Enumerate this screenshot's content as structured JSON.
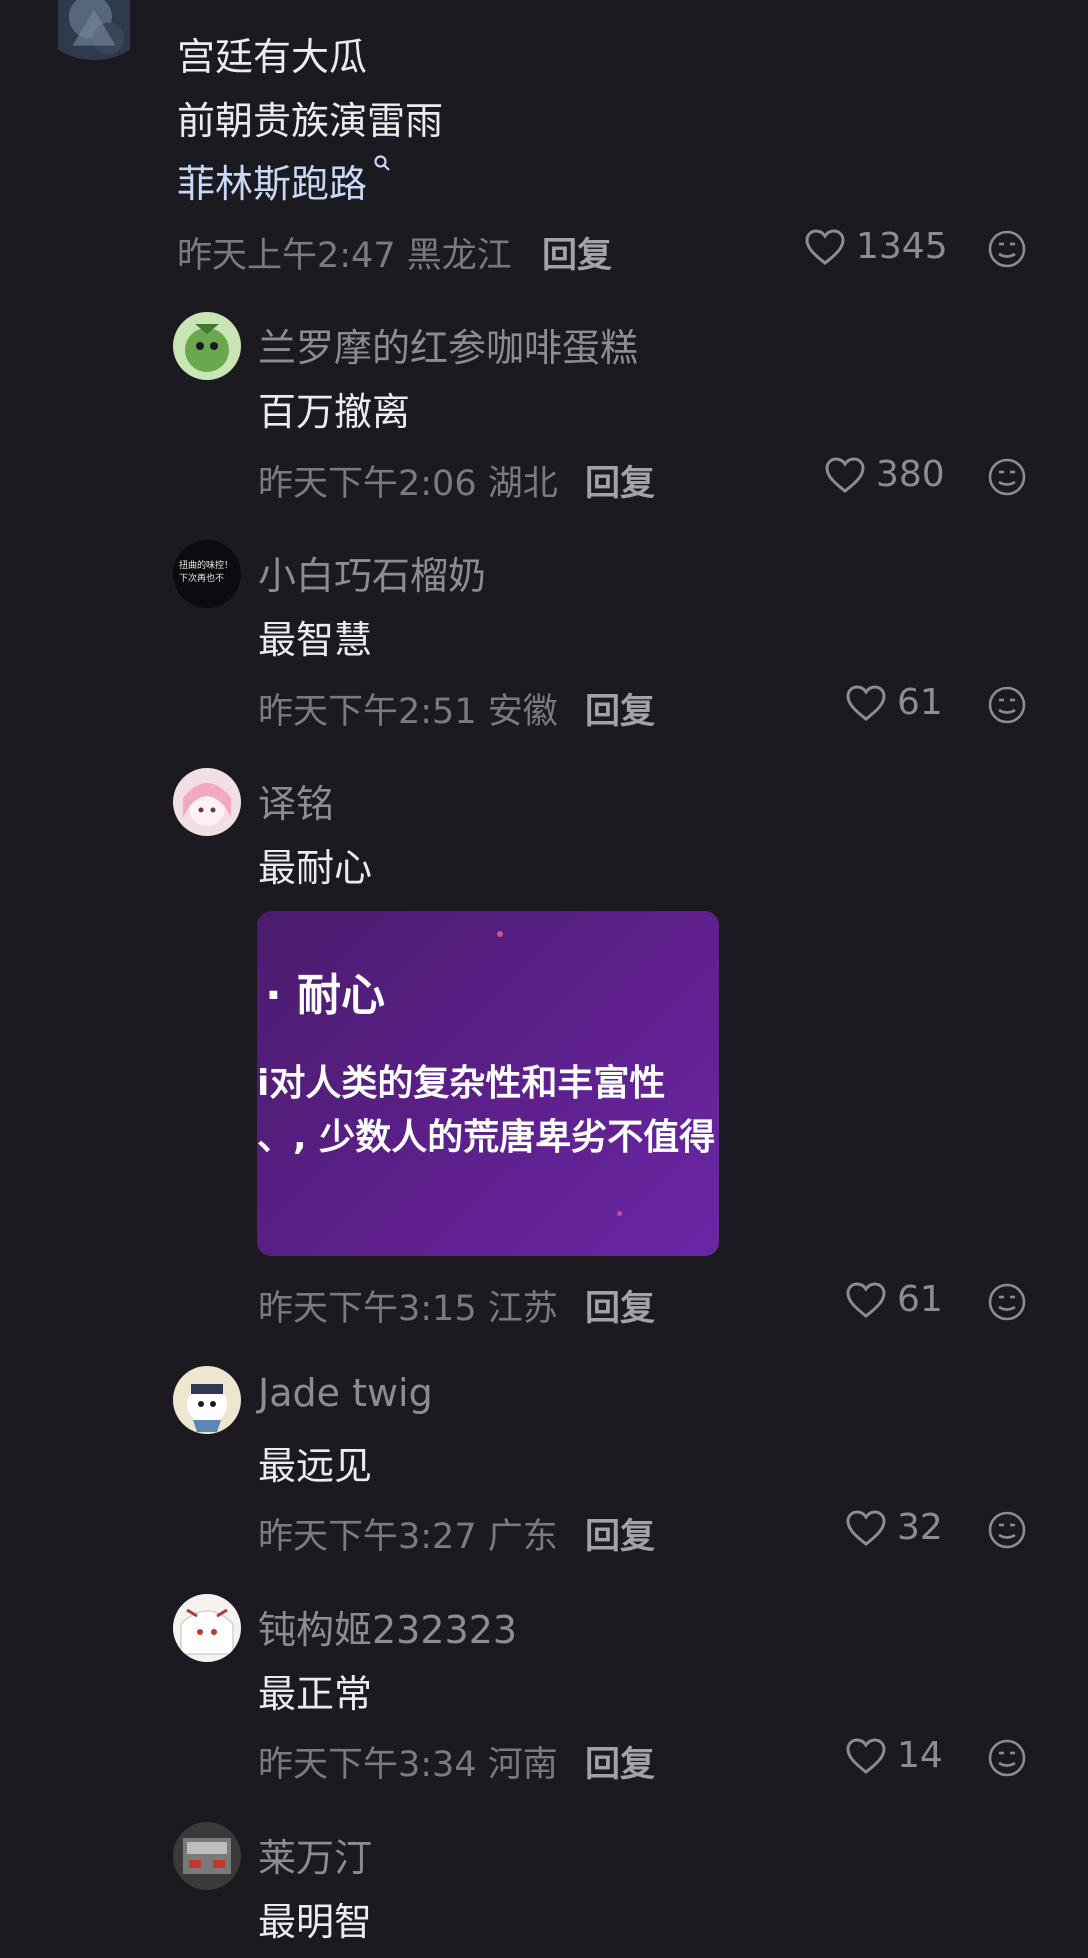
{
  "top_comment": {
    "lines": [
      "宫廷有大瓜",
      "前朝贵族演雷雨"
    ],
    "search_link": "菲林斯跑路",
    "time": "昨天上午2:47",
    "location": "黑龙江",
    "reply_label": "回复",
    "likes": "1345"
  },
  "replies": [
    {
      "name": "兰罗摩的红参咖啡蛋糕",
      "text": "百万撤离",
      "time": "昨天下午2:06",
      "location": "湖北",
      "reply_label": "回复",
      "likes": "380"
    },
    {
      "name": "小白巧石榴奶",
      "text": "最智慧",
      "time": "昨天下午2:51",
      "location": "安徽",
      "reply_label": "回复",
      "likes": "61",
      "avatar_text": [
        "扭曲的味控！",
        "下次再也不"
      ]
    },
    {
      "name": "译铭",
      "text": "最耐心",
      "time": "昨天下午3:15",
      "location": "江苏",
      "reply_label": "回复",
      "likes": "61",
      "image_text": {
        "title": "· 耐心",
        "line1": "i对人类的复杂性和丰富性",
        "line2": "、, 少数人的荒唐卑劣不值得"
      }
    },
    {
      "name": "Jade twig",
      "text": "最远见",
      "time": "昨天下午3:27",
      "location": "广东",
      "reply_label": "回复",
      "likes": "32"
    },
    {
      "name": "钝构姬232323",
      "text": "最正常",
      "time": "昨天下午3:34",
      "location": "河南",
      "reply_label": "回复",
      "likes": "14"
    },
    {
      "name": "莱万汀",
      "text": "最明智"
    }
  ],
  "icons": {
    "like": "heart-outline-icon",
    "emoji": "emoji-face-icon",
    "search": "search-icon"
  },
  "colors": {
    "background": "#1b1a21",
    "name": "#8d8b94",
    "text": "#ececef",
    "meta": "#7b7982",
    "link": "#c9d8f4"
  }
}
